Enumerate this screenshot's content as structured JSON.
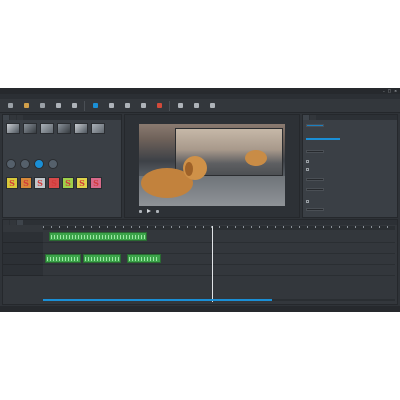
{
  "colors": {
    "accent": "#1a8fd6",
    "clip": "#3ca34a",
    "background": "#2f3338"
  },
  "toolbar": {
    "items": [
      {
        "icon": "new-icon",
        "color": "#9aa0a6"
      },
      {
        "icon": "open-icon",
        "color": "#d2a04a"
      },
      {
        "icon": "save-icon",
        "color": "#9aa0a6"
      },
      {
        "icon": "undo-icon",
        "color": "#aeb3b9"
      },
      {
        "icon": "redo-icon",
        "color": "#aeb3b9"
      },
      {
        "icon": "select-icon",
        "color": "#1a8fd6"
      },
      {
        "icon": "razor-icon",
        "color": "#aeb3b9"
      },
      {
        "icon": "spacer-icon",
        "color": "#aeb3b9"
      },
      {
        "icon": "snap-icon",
        "color": "#aeb3b9"
      },
      {
        "icon": "render-icon",
        "color": "#d24a3a"
      },
      {
        "icon": "layout-icon",
        "color": "#aeb3b9"
      },
      {
        "icon": "layout-icon",
        "color": "#aeb3b9"
      },
      {
        "icon": "layout-icon",
        "color": "#aeb3b9"
      }
    ]
  },
  "effects": {
    "swatches": [
      {
        "glyph": "S",
        "color": "#d8c93a"
      },
      {
        "glyph": "S",
        "color": "#d88a3a"
      },
      {
        "glyph": "S",
        "color": "#c2c6ca"
      },
      {
        "glyph": "S",
        "color": "#d84a4a"
      },
      {
        "glyph": "S",
        "color": "#9fd04a"
      },
      {
        "glyph": "S",
        "color": "#e0d34a"
      },
      {
        "glyph": "S",
        "color": "#d86a8a"
      }
    ]
  },
  "timeline": {
    "playhead_fraction": 0.48,
    "scroll_fraction": 0.65
  }
}
